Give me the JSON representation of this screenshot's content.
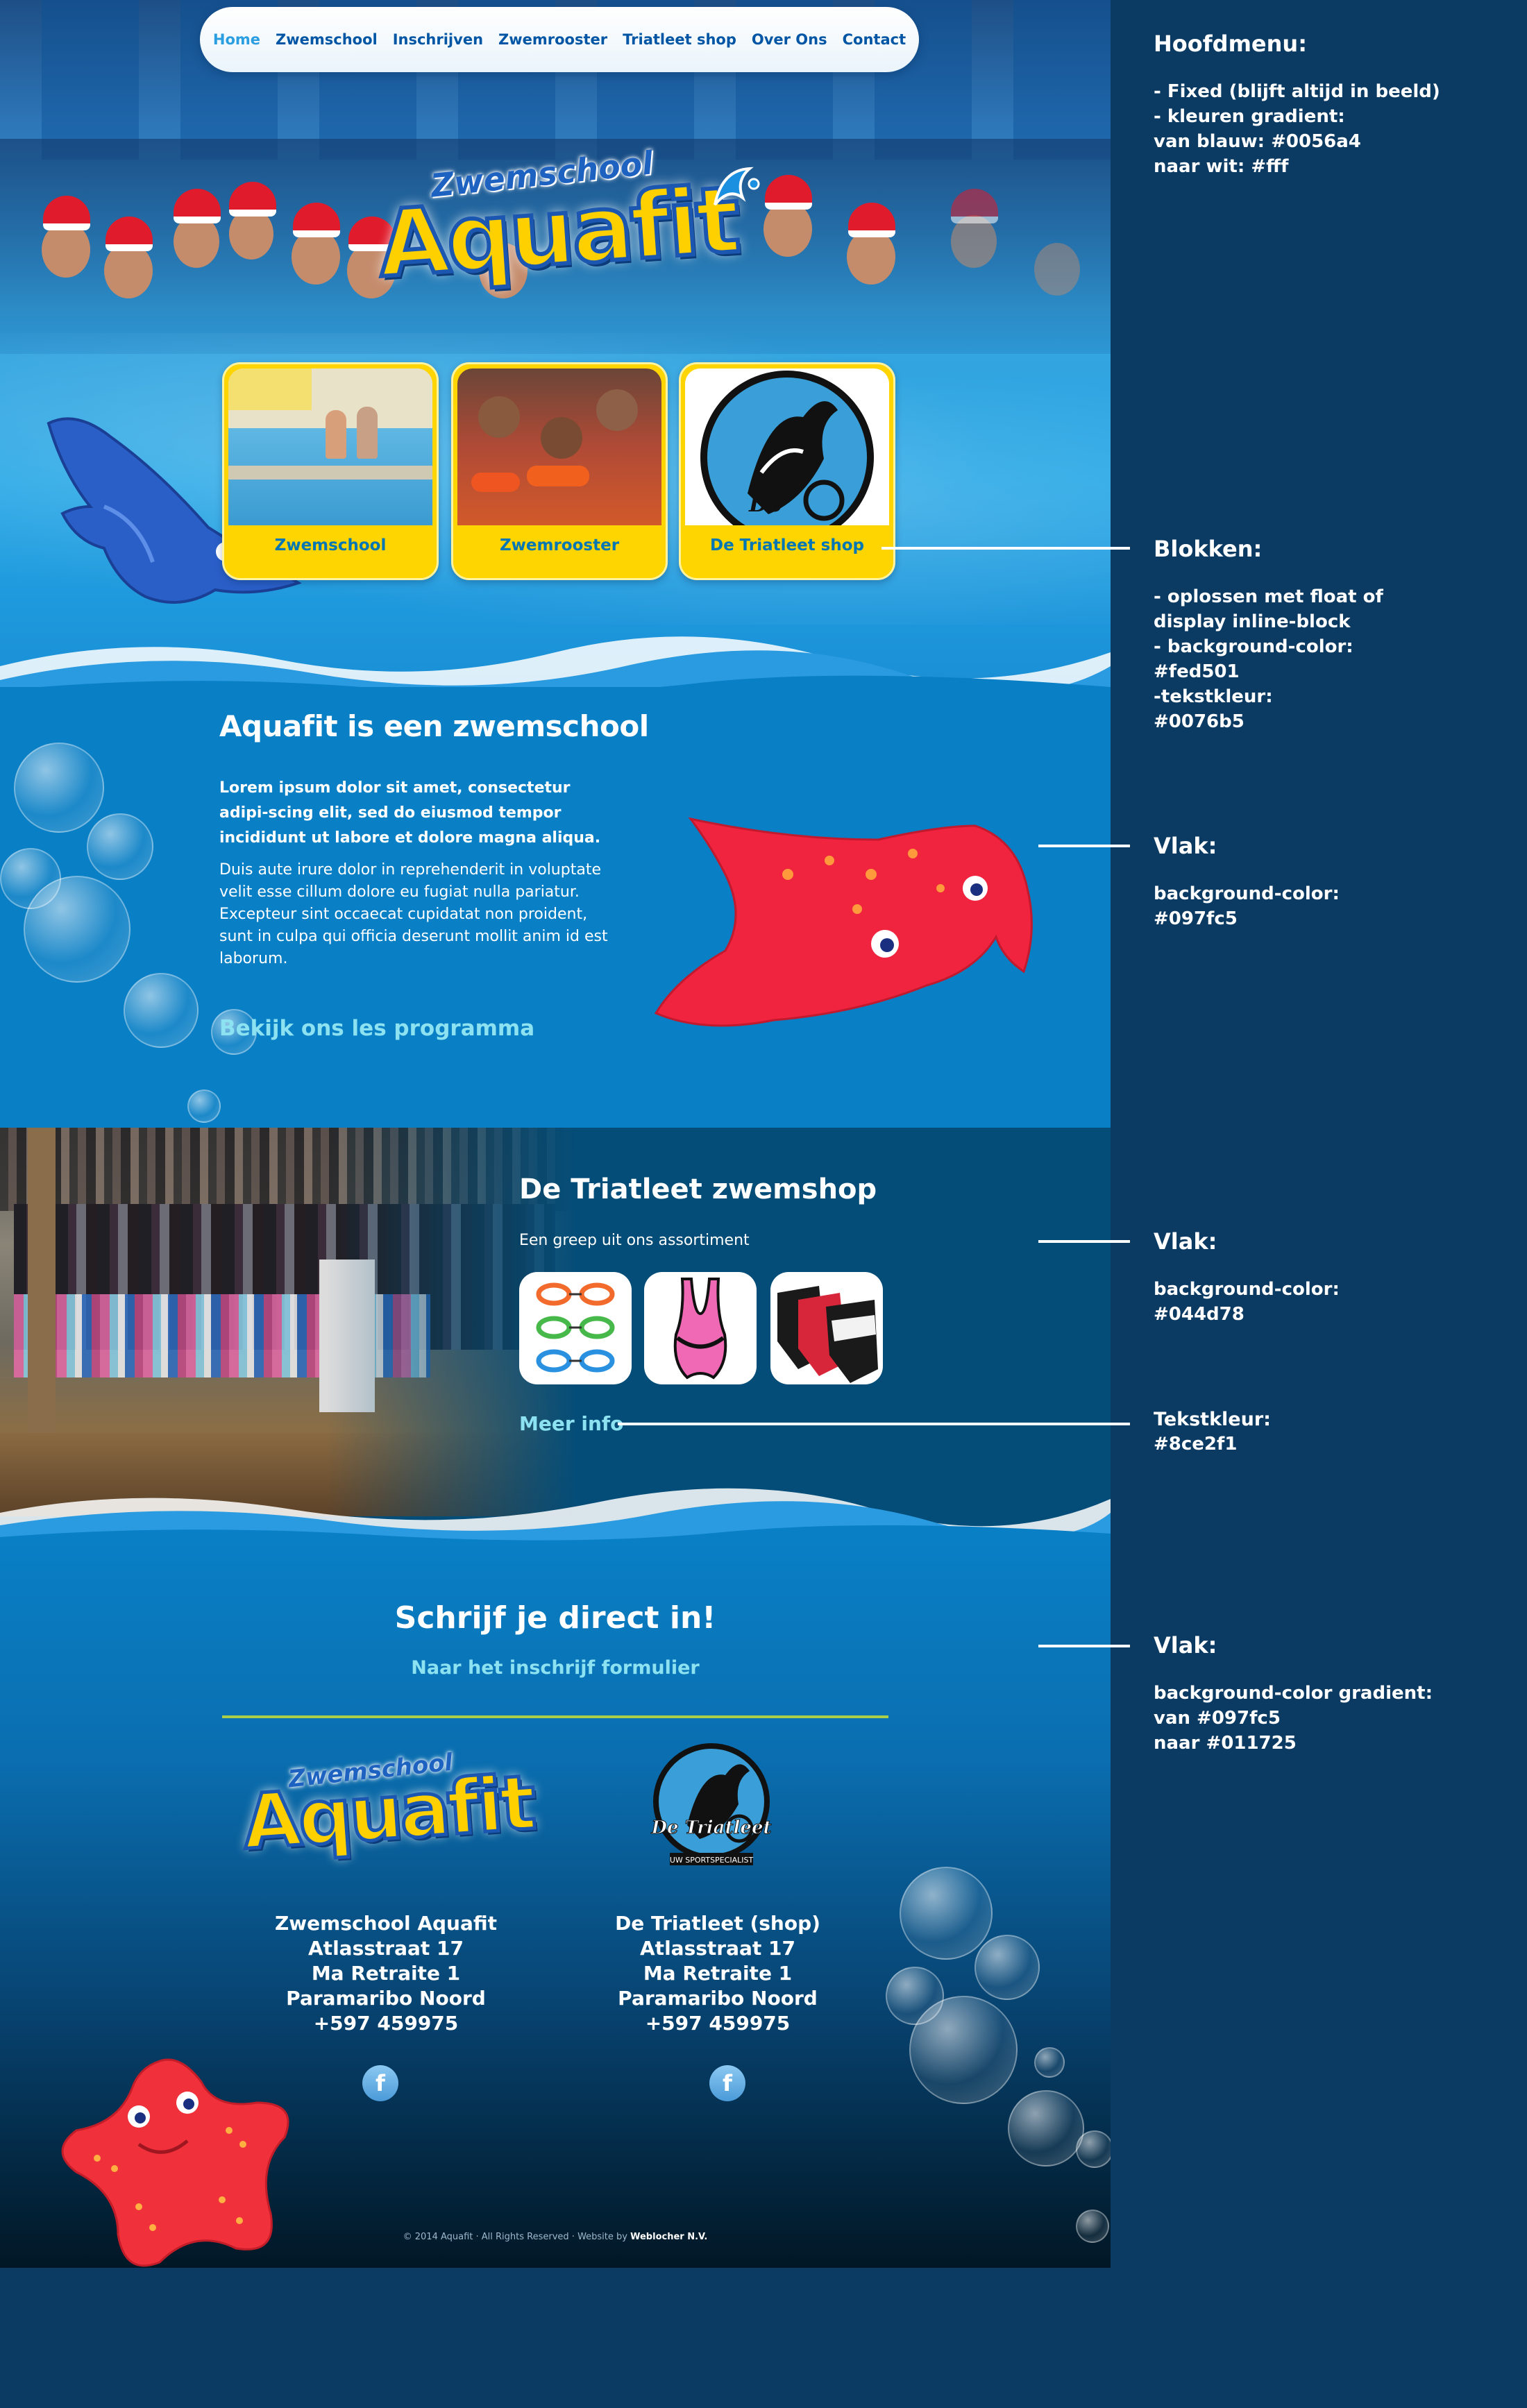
{
  "nav": {
    "items": [
      "Home",
      "Zwemschool",
      "Inschrijven",
      "Zwemrooster",
      "Triatleet shop",
      "Over Ons",
      "Contact"
    ]
  },
  "hero": {
    "logo_sub": "Zwemschool",
    "logo_main": "Aquafit",
    "blocks": [
      "Zwemschool",
      "Zwemrooster",
      "De Triatleet shop"
    ],
    "triatleet_badge": "De"
  },
  "intro": {
    "title": "Aquafit is een zwemschool",
    "lead": "Lorem ipsum dolor sit amet, consectetur adipi-scing elit, sed do eiusmod tempor incididunt ut labore et dolore magna aliqua.",
    "body": "Duis aute irure dolor in reprehenderit in voluptate velit esse cillum dolore eu fugiat nulla pariatur. Excepteur sint occaecat cupidatat non proident, sunt in culpa qui officia deserunt mollit anim id est laborum.",
    "link": "Bekijk ons les programma"
  },
  "shop": {
    "title": "De Triatleet zwemshop",
    "subtitle": "Een greep uit ons assortiment",
    "more": "Meer info"
  },
  "signup": {
    "title": "Schrijf je direct in!",
    "cta": "Naar het inschrijf formulier"
  },
  "footer": {
    "logo_sub": "Zwemschool",
    "logo_main": "Aquafit",
    "triatleet_logo_text": "De Triatleet",
    "triatleet_logo_tag": "UW SPORTSPECIALIST",
    "address_left": [
      "Zwemschool Aquafit",
      "Atlasstraat 17",
      "Ma Retraite 1",
      "Paramaribo Noord",
      "+597 459975"
    ],
    "address_right": [
      "De Triatleet (shop)",
      "Atlasstraat 17",
      "Ma Retraite 1",
      "Paramaribo Noord",
      "+597 459975"
    ],
    "facebook": "f",
    "copyright": "© 2014 Aquafit · All Rights Reserved · Website by",
    "copyright_by": "Weblocher N.V."
  },
  "annotations": [
    {
      "title": "Hoofdmenu:",
      "text": "- Fixed (blijft altijd in beeld)\n- kleuren gradient:\nvan blauw:  #0056a4\nnaar wit:  #fff"
    },
    {
      "title": "Blokken:",
      "text": "- oplossen met float of\ndisplay inline-block\n- background-color:\n#fed501\n-tekstkleur:\n#0076b5"
    },
    {
      "title": "Vlak:",
      "text": "background-color:\n#097fc5"
    },
    {
      "title": "Vlak:",
      "text": "background-color:\n#044d78"
    },
    {
      "title": "Tekstkleur:",
      "text": "#8ce2f1"
    },
    {
      "title": "Vlak:",
      "text": "background-color gradient:\nvan #097fc5\nnaar #011725"
    }
  ],
  "colors": {
    "nav_text": "#0056a4",
    "block_bg": "#fed501",
    "block_text": "#0076b5",
    "section_intro": "#097fc5",
    "section_shop": "#044d78",
    "link": "#8ce2f1",
    "footer_end": "#011725"
  }
}
